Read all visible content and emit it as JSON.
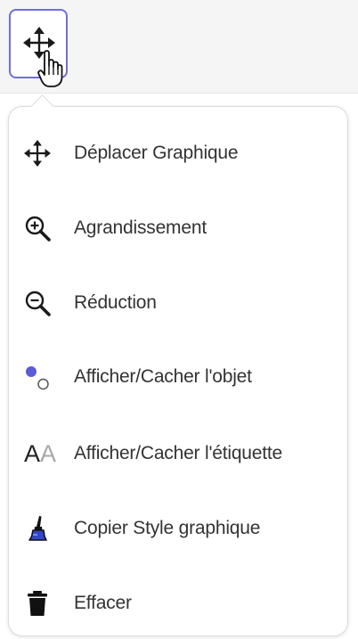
{
  "toolbar": {
    "active_tool_icon": "move-cross-arrows-icon",
    "cursor_icon": "hand-pointer-icon",
    "accent_color": "#6f6ee0"
  },
  "menu": {
    "items": [
      {
        "label": "Déplacer Graphique",
        "icon": "move-cross-arrows-icon"
      },
      {
        "label": "Agrandissement",
        "icon": "zoom-in-icon"
      },
      {
        "label": "Réduction",
        "icon": "zoom-out-icon"
      },
      {
        "label": "Afficher/Cacher l'objet",
        "icon": "show-hide-object-icon",
        "icon_color": "#5b5bd6"
      },
      {
        "label": "Afficher/Cacher l'étiquette",
        "icon": "show-hide-label-icon",
        "icon_text_dark": "A",
        "icon_text_light": "A"
      },
      {
        "label": "Copier Style graphique",
        "icon": "paintbrush-icon",
        "icon_color": "#3344cc"
      },
      {
        "label": "Effacer",
        "icon": "trash-icon"
      }
    ]
  }
}
